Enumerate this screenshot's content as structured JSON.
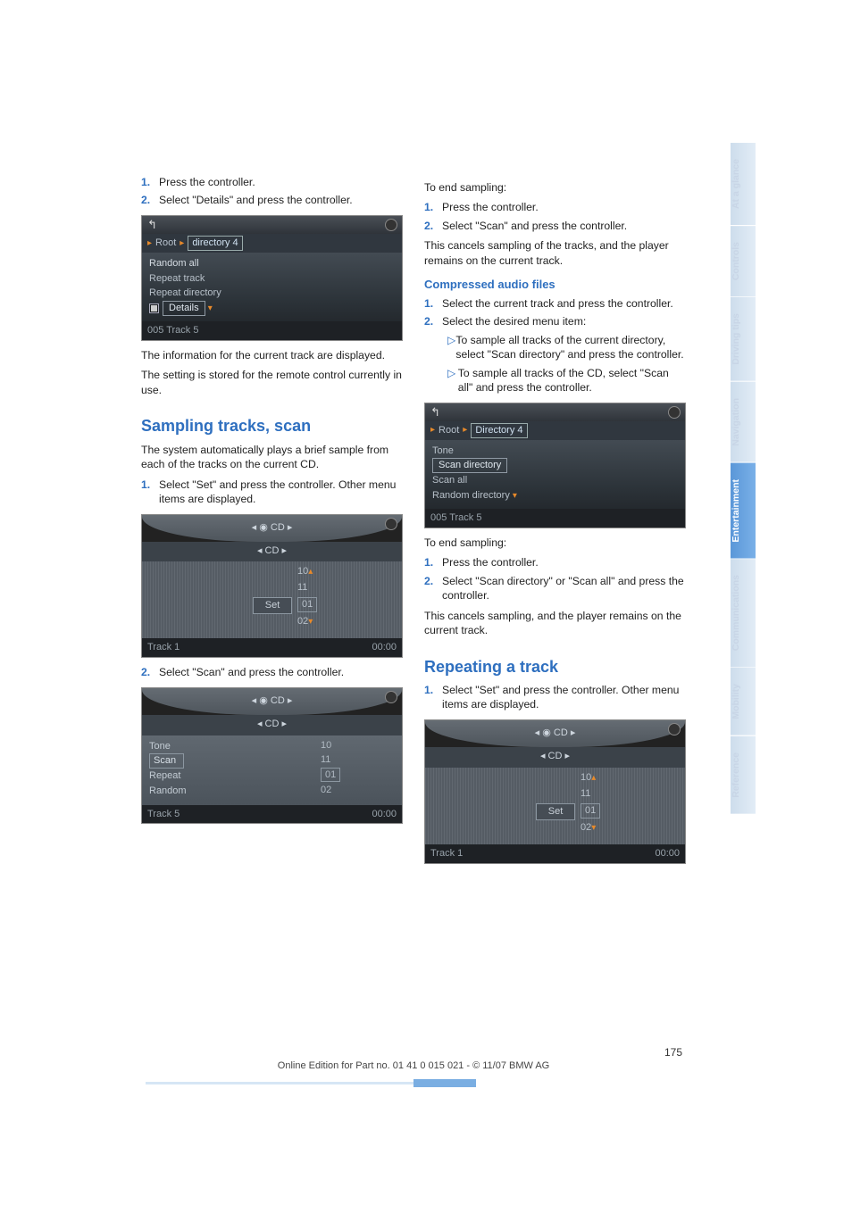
{
  "left": {
    "steps_a": [
      {
        "n": "1.",
        "t": "Press the controller."
      },
      {
        "n": "2.",
        "t": "Select \"Details\" and press the controller."
      }
    ],
    "screen1": {
      "bc1": "Root",
      "bc2": "directory 4",
      "items": [
        "Random all",
        "Repeat track",
        "Repeat directory"
      ],
      "details": "Details",
      "track": "005 Track 5"
    },
    "para1": "The information for the current track are displayed.",
    "para2": "The setting is stored for the remote control currently in use.",
    "h2_sampling": "Sampling tracks, scan",
    "para3": "The system automatically plays a brief sample from each of the tracks on the current CD.",
    "steps_b": [
      {
        "n": "1.",
        "t": "Select \"Set\" and press the controller. Other menu items are displayed."
      }
    ],
    "screen2": {
      "top": "CD",
      "sub": "CD",
      "set": "Set",
      "nums": [
        "10",
        "11",
        "01",
        "02"
      ],
      "track": "Track 1",
      "time": "00:00"
    },
    "steps_c": [
      {
        "n": "2.",
        "t": "Select \"Scan\" and press the controller."
      }
    ],
    "screen3": {
      "top": "CD",
      "sub": "CD",
      "rows": [
        "Tone",
        "Scan",
        "Repeat",
        "Random"
      ],
      "nums": [
        "10",
        "11",
        "01",
        "02"
      ],
      "track": "Track 5",
      "time": "00:00"
    }
  },
  "right": {
    "end1": "To end sampling:",
    "steps_d": [
      {
        "n": "1.",
        "t": "Press the controller."
      },
      {
        "n": "2.",
        "t": "Select \"Scan\" and press the controller."
      }
    ],
    "para4": "This cancels sampling of the tracks, and the player remains on the current track.",
    "h3_caf": "Compressed audio files",
    "steps_e": [
      {
        "n": "1.",
        "t": "Select the current track and press the controller."
      },
      {
        "n": "2.",
        "t": "Select the desired menu item:"
      }
    ],
    "subs": [
      "To sample all tracks of the current directory, select \"Scan directory\" and press the controller.",
      "To sample all tracks of the CD, select \"Scan all\" and press the controller."
    ],
    "screen4": {
      "bc1": "Root",
      "bc2": "Directory 4",
      "items_top": "Tone",
      "items_box": "Scan directory",
      "items_rest": [
        "Scan all",
        "Random directory"
      ],
      "track": "005 Track 5"
    },
    "end2": "To end sampling:",
    "steps_f": [
      {
        "n": "1.",
        "t": "Press the controller."
      },
      {
        "n": "2.",
        "t": "Select \"Scan directory\" or \"Scan all\" and press the controller."
      }
    ],
    "para5": "This cancels sampling, and the player remains on the current track.",
    "h2_repeat": "Repeating a track",
    "steps_g": [
      {
        "n": "1.",
        "t": "Select \"Set\" and press the controller. Other menu items are displayed."
      }
    ],
    "screen5": {
      "top": "CD",
      "sub": "CD",
      "set": "Set",
      "nums": [
        "10",
        "11",
        "01",
        "02"
      ],
      "track": "Track 1",
      "time": "00:00"
    }
  },
  "tabs": [
    "At a glance",
    "Controls",
    "Driving tips",
    "Navigation",
    "Entertainment",
    "Communications",
    "Mobility",
    "Reference"
  ],
  "tabs_active_index": 4,
  "page_number": "175",
  "footer": "Online Edition for Part no. 01 41 0 015 021 - © 11/07 BMW AG"
}
